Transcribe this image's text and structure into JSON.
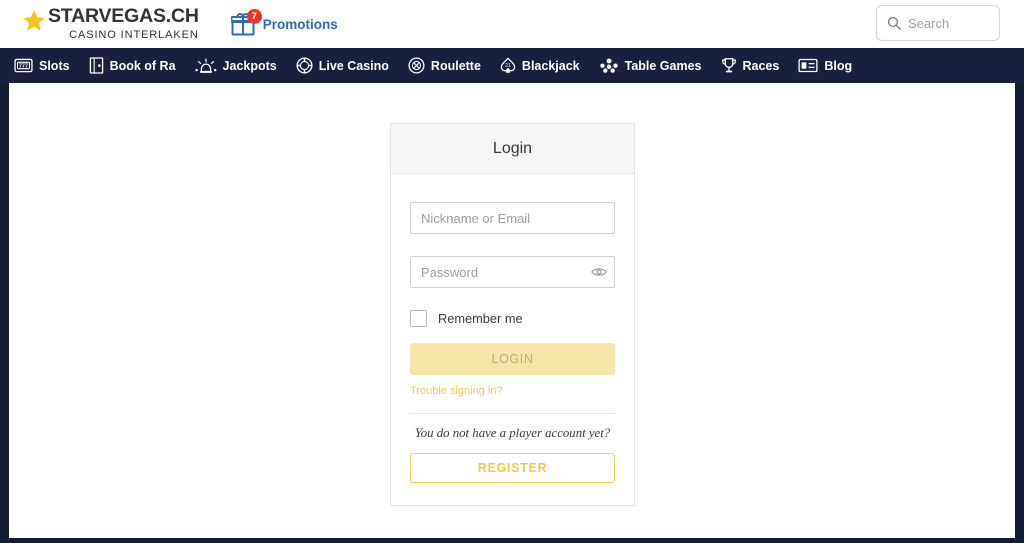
{
  "header": {
    "logo": {
      "icon": "star-icon",
      "main_text": "STARVEGAS.CH",
      "sub_text": "CASINO INTERLAKEN"
    },
    "promotions": {
      "icon": "gift-icon",
      "badge_count": "7",
      "label": "Promotions",
      "color": "#2b6bc4",
      "badge_color": "#e8372a"
    },
    "search": {
      "icon": "search-icon",
      "placeholder": "Search",
      "value": ""
    }
  },
  "nav": {
    "background": "#19203f",
    "items": [
      {
        "icon": "slot-machine-icon",
        "label": "Slots"
      },
      {
        "icon": "book-icon",
        "label": "Book of Ra"
      },
      {
        "icon": "jackpot-siren-icon",
        "label": "Jackpots"
      },
      {
        "icon": "casino-chip-icon",
        "label": "Live Casino"
      },
      {
        "icon": "roulette-chip-icon",
        "label": "Roulette"
      },
      {
        "icon": "spade-21-icon",
        "label": "Blackjack"
      },
      {
        "icon": "table-games-icon",
        "label": "Table Games"
      },
      {
        "icon": "trophy-icon",
        "label": "Races"
      },
      {
        "icon": "article-icon",
        "label": "Blog"
      }
    ]
  },
  "login_card": {
    "title": "Login",
    "username": {
      "placeholder": "Nickname or Email",
      "value": ""
    },
    "password": {
      "placeholder": "Password",
      "value": "",
      "toggle_icon": "eye-icon"
    },
    "remember_me": {
      "label": "Remember me",
      "checked": false
    },
    "login_button": {
      "label": "LOGIN",
      "background": "#f8e5a8",
      "text_color": "#b9a97e",
      "disabled": true
    },
    "trouble_link": {
      "label": "Trouble signing in?",
      "color": "#f2ca4c"
    },
    "no_account_text": "You do not have a player account yet?",
    "register_button": {
      "label": "REGISTER",
      "border_color": "#f0d25e",
      "text_color": "#f1c94a"
    }
  }
}
